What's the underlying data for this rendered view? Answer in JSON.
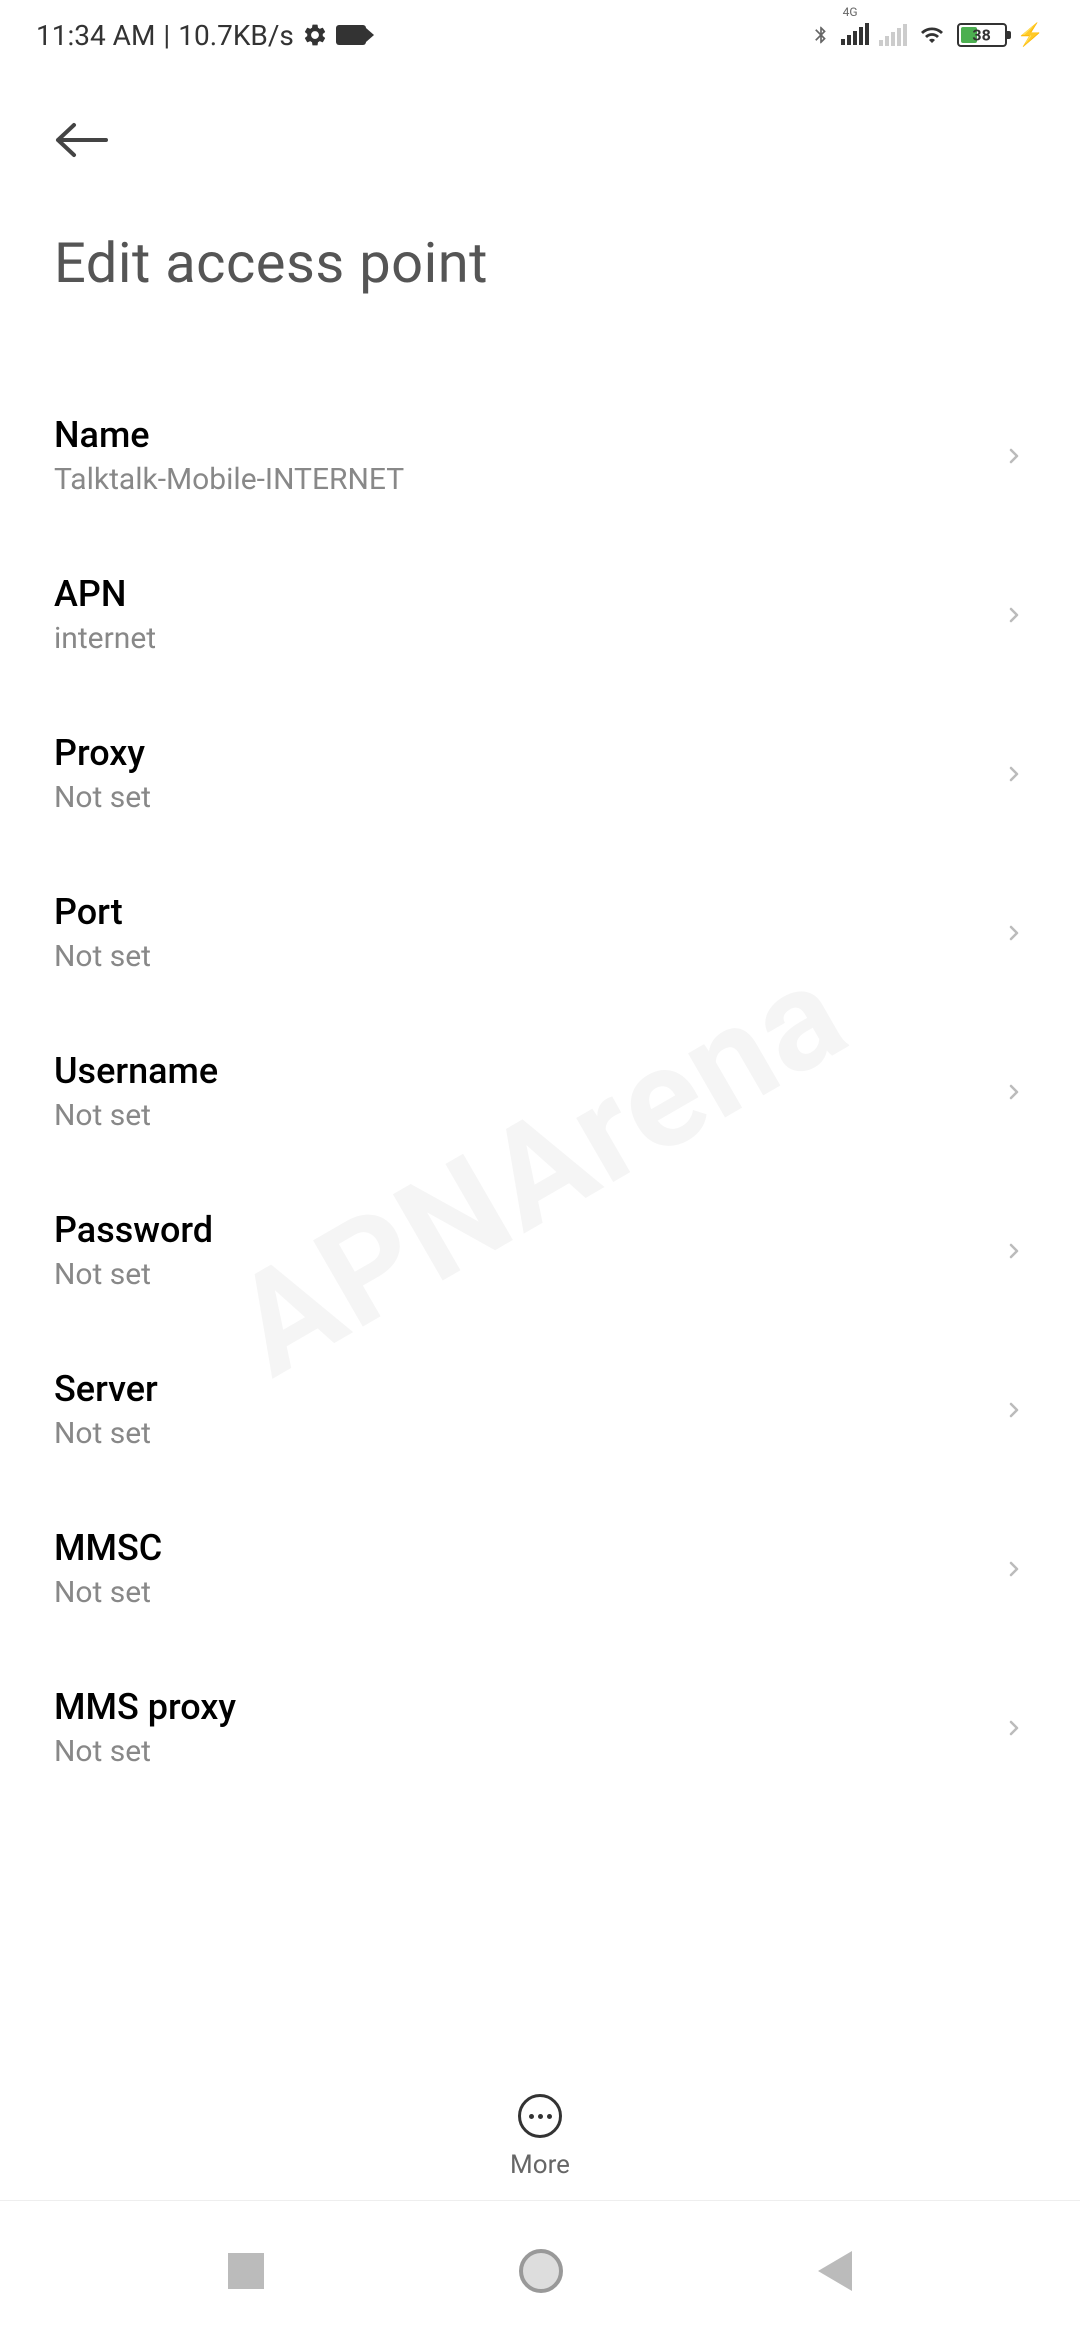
{
  "status_bar": {
    "time": "11:34 AM",
    "separator": " | ",
    "data_rate": "10.7KB/s",
    "network_label": "4G",
    "battery_percent": "38"
  },
  "header": {
    "title": "Edit access point"
  },
  "settings": [
    {
      "label": "Name",
      "value": "Talktalk-Mobile-INTERNET"
    },
    {
      "label": "APN",
      "value": "internet"
    },
    {
      "label": "Proxy",
      "value": "Not set"
    },
    {
      "label": "Port",
      "value": "Not set"
    },
    {
      "label": "Username",
      "value": "Not set"
    },
    {
      "label": "Password",
      "value": "Not set"
    },
    {
      "label": "Server",
      "value": "Not set"
    },
    {
      "label": "MMSC",
      "value": "Not set"
    },
    {
      "label": "MMS proxy",
      "value": "Not set"
    }
  ],
  "bottom_action": {
    "label": "More"
  },
  "watermark": "APNArena"
}
